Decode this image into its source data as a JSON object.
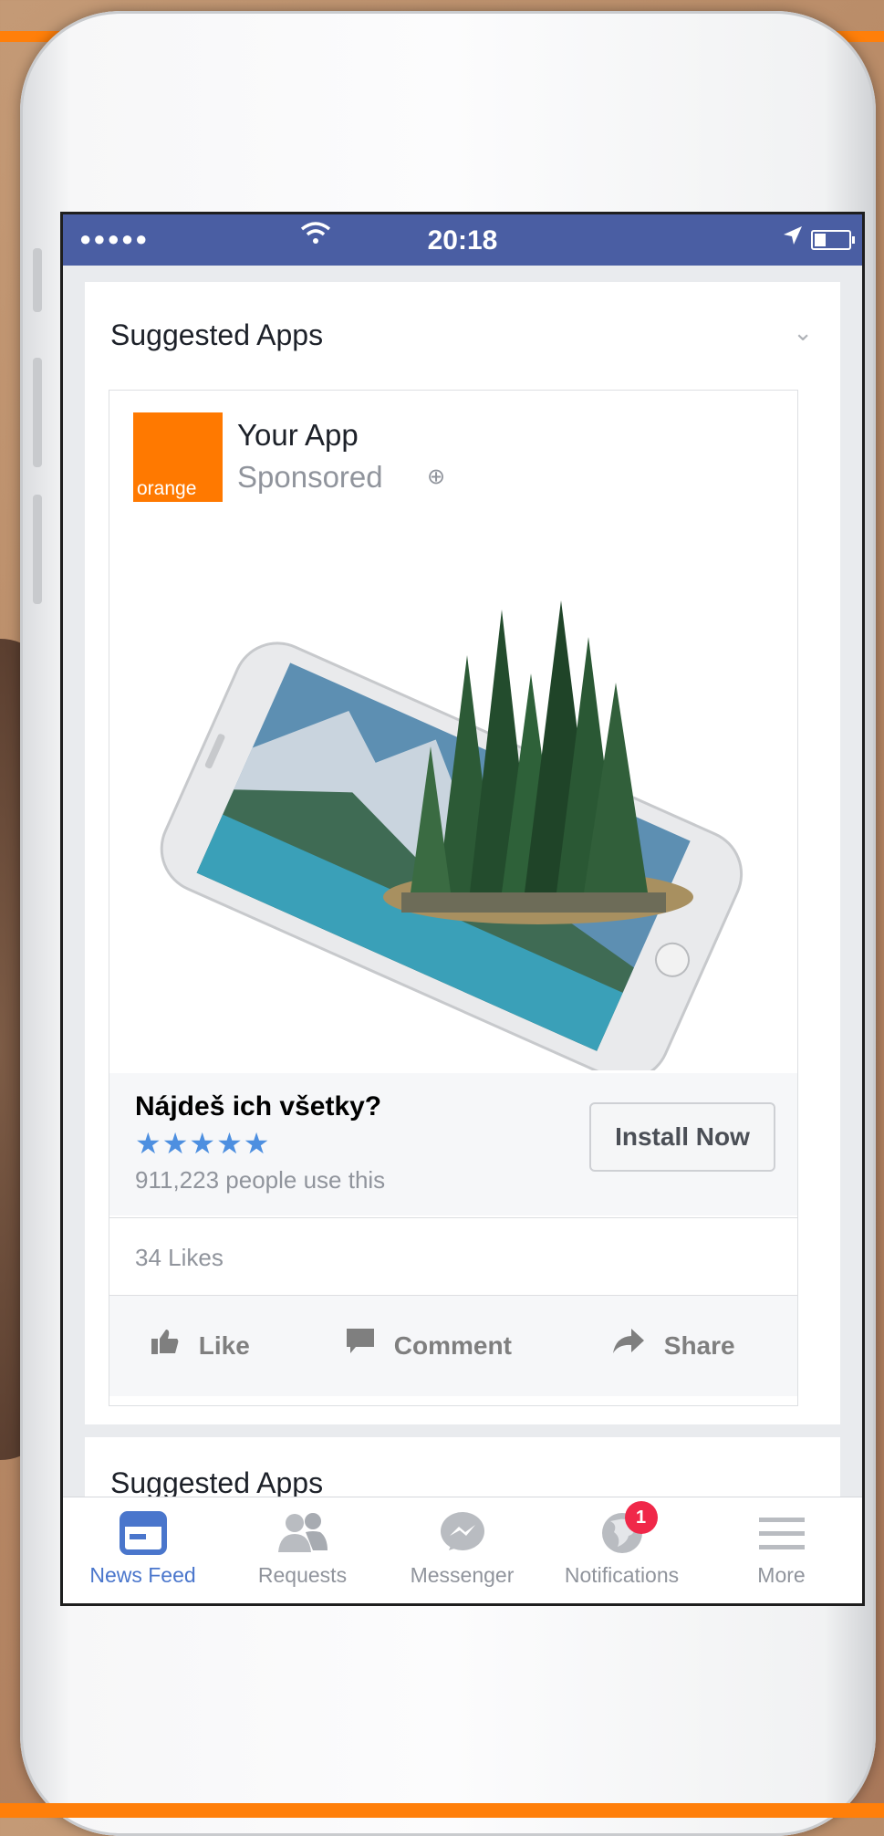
{
  "status_bar": {
    "signal": "●●●●●",
    "time": "20:18"
  },
  "feed": {
    "card_title": "Suggested Apps",
    "ad": {
      "logo_text": "orange",
      "app_name": "Your App",
      "sponsored_label": "Sponsored",
      "headline": "Nájdeš ich všetky?",
      "rating": 4.5,
      "stars_text": "★★★★★",
      "users_text": "911,223  people use this",
      "install_label": "Install Now",
      "likes_text": "34 Likes",
      "actions": {
        "like": "Like",
        "comment": "Comment",
        "share": "Share"
      }
    },
    "next_card_title": "Suggested Apps"
  },
  "tabbar": {
    "tabs": [
      {
        "label": "News Feed",
        "icon": "news-feed-icon",
        "active": true
      },
      {
        "label": "Requests",
        "icon": "requests-icon"
      },
      {
        "label": "Messenger",
        "icon": "messenger-icon"
      },
      {
        "label": "Notifications",
        "icon": "globe-icon",
        "badge": "1"
      },
      {
        "label": "More",
        "icon": "menu-icon"
      }
    ]
  },
  "colors": {
    "accent_orange": "#ff7f0a",
    "facebook_blue": "#4a5ea3",
    "star_blue": "#4d8fe0",
    "badge_red": "#f02849"
  }
}
